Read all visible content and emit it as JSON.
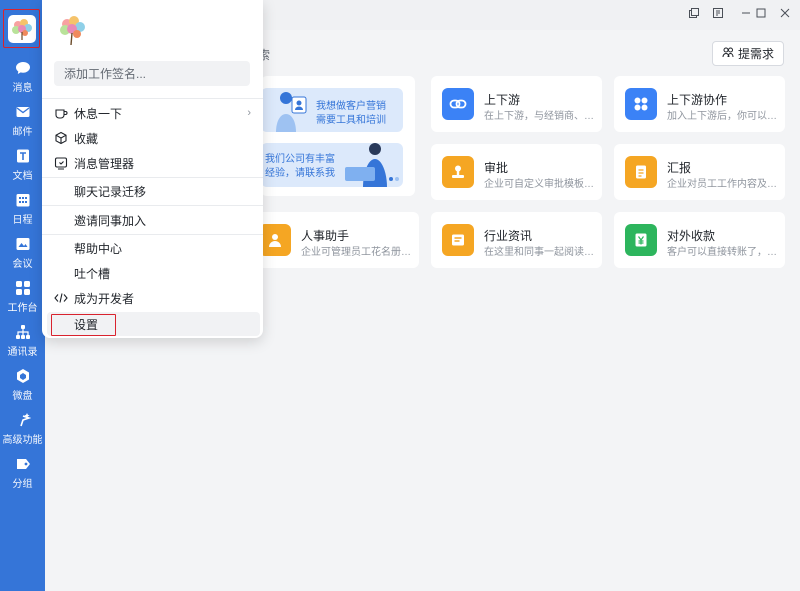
{
  "sidebar": {
    "items": [
      {
        "label": "消息",
        "icon": "chat-bubble-icon"
      },
      {
        "label": "邮件",
        "icon": "mail-icon"
      },
      {
        "label": "文档",
        "icon": "document-icon"
      },
      {
        "label": "日程",
        "icon": "calendar-icon"
      },
      {
        "label": "会议",
        "icon": "meeting-icon"
      },
      {
        "label": "工作台",
        "icon": "workbench-grid-icon"
      },
      {
        "label": "通讯录",
        "icon": "org-chart-icon"
      },
      {
        "label": "微盘",
        "icon": "cloud-drive-icon"
      },
      {
        "label": "高级功能",
        "icon": "sparkle-icon"
      },
      {
        "label": "分组",
        "icon": "tag-icon"
      }
    ],
    "active": "工作台"
  },
  "titlebar": {
    "buttons": [
      "pin-window-icon",
      "feedback-icon",
      "minimize-icon",
      "maximize-icon",
      "close-icon"
    ]
  },
  "main": {
    "search_text_fragment": "索",
    "request_button": "提需求",
    "banner": {
      "line1": "我想做客户营销",
      "line2": "需要工具和培训",
      "line3": "我们公司有丰富",
      "line4": "经验，请联系我"
    },
    "cards": [
      {
        "title": "上下游",
        "desc": "在上下游，与经销商、供...",
        "color": "#3b82f6",
        "icon": "link-icon"
      },
      {
        "title": "上下游协作",
        "desc": "加入上下游后，你可以便...",
        "color": "#3b82f6",
        "icon": "four-dots-icon"
      },
      {
        "title": "审批",
        "desc": "企业可自定义审批模板、...",
        "color": "#f5a623",
        "icon": "stamp-icon"
      },
      {
        "title": "汇报",
        "desc": "企业对员工工作内容及过...",
        "color": "#f5a623",
        "icon": "report-icon"
      },
      {
        "title": "人事助手",
        "desc": "企业可管理员工花名册信...",
        "color": "#f5a623",
        "icon": "person-icon"
      },
      {
        "title": "行业资讯",
        "desc": "在这里和同事一起阅读行...",
        "color": "#f5a623",
        "icon": "news-icon"
      },
      {
        "title": "对外收款",
        "desc": "客户可以直接转账了，成...",
        "color": "#2db55d",
        "icon": "yen-icon"
      }
    ]
  },
  "menu": {
    "signature_placeholder": "添加工作签名...",
    "items": [
      {
        "label": "休息一下",
        "icon": "coffee-cup-icon",
        "has_arrow": true
      },
      {
        "label": "收藏",
        "icon": "cube-icon"
      },
      {
        "label": "消息管理器",
        "icon": "message-manager-icon"
      },
      {
        "label": "聊天记录迁移",
        "icon": ""
      },
      {
        "label": "邀请同事加入",
        "icon": ""
      },
      {
        "label": "帮助中心",
        "icon": ""
      },
      {
        "label": "吐个槽",
        "icon": ""
      },
      {
        "label": "成为开发者",
        "icon": "code-icon"
      },
      {
        "label": "设置",
        "icon": ""
      }
    ],
    "arrow_glyph": "›"
  }
}
